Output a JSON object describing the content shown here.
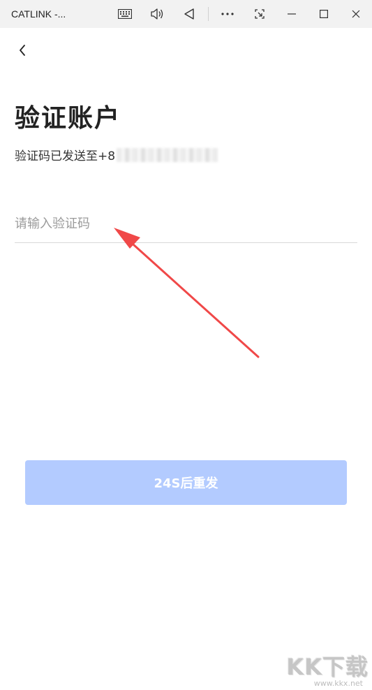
{
  "window": {
    "title": "CATLINK -...",
    "buttons": [
      "keyboard-icon",
      "volume-icon",
      "back-triangle-icon",
      "more-icon",
      "snip-icon",
      "minimize-icon",
      "maximize-icon",
      "close-icon"
    ]
  },
  "header": {
    "back_icon": "chevron-left-icon"
  },
  "main": {
    "title": "验证账户",
    "subtitle_prefix": "验证码已发送至+8",
    "code_input": {
      "value": "",
      "placeholder": "请输入验证码"
    },
    "resend_button": "24S后重发"
  },
  "watermark": {
    "logo": "KK下载",
    "url": "www.kkx.net"
  },
  "colors": {
    "button_bg": "#b3cbff",
    "arrow": "#f04848",
    "titlebar_bg": "#f2f2f2",
    "text": "#222222",
    "placeholder": "#9a9a9a"
  }
}
